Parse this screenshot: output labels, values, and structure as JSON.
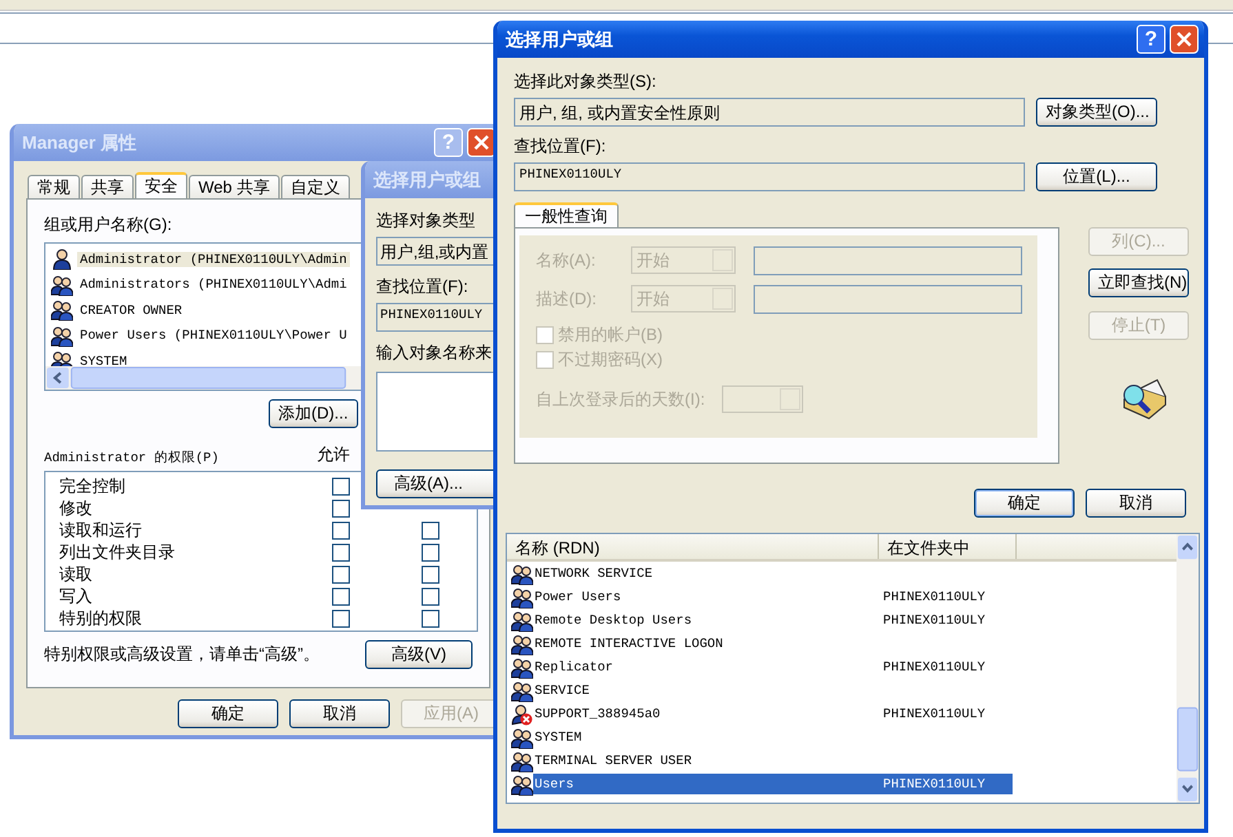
{
  "property_window": {
    "title": "Manager 属性",
    "help": "?",
    "tabs": [
      {
        "label": "常规",
        "selected": false
      },
      {
        "label": "共享",
        "selected": false
      },
      {
        "label": "安全",
        "selected": true
      },
      {
        "label": "Web 共享",
        "selected": false
      },
      {
        "label": "自定义",
        "selected": false
      }
    ],
    "group_label": "组或用户名称(G):",
    "groups": [
      {
        "name": "Administrator (PHINEX0110ULY\\Admin",
        "kind": "user",
        "selected": true
      },
      {
        "name": "Administrators (PHINEX0110ULY\\Admi",
        "kind": "group",
        "selected": false
      },
      {
        "name": "CREATOR OWNER",
        "kind": "group",
        "selected": false
      },
      {
        "name": "Power Users (PHINEX0110ULY\\Power U",
        "kind": "group",
        "selected": false
      },
      {
        "name": "SYSTEM",
        "kind": "group",
        "selected": false
      }
    ],
    "add_button": "添加(D)...",
    "permissions_label": "Administrator 的权限(P)",
    "allow_header": "允许",
    "permissions": [
      {
        "name": "完全控制",
        "allow": false
      },
      {
        "name": "修改",
        "allow": false
      },
      {
        "name": "读取和运行",
        "allow": false,
        "deny": false
      },
      {
        "name": "列出文件夹目录",
        "allow": false,
        "deny": false
      },
      {
        "name": "读取",
        "allow": false,
        "deny": false
      },
      {
        "name": "写入",
        "allow": false,
        "deny": false
      },
      {
        "name": "特别的权限",
        "allow": false,
        "deny": false
      }
    ],
    "advanced_hint": "特别权限或高级设置，请单击“高级”。",
    "advanced_button": "高级(V)",
    "buttons": [
      {
        "label": "确定",
        "disabled": false
      },
      {
        "label": "取消",
        "disabled": false
      },
      {
        "label": "应用(A)",
        "disabled": true
      }
    ]
  },
  "middle_window": {
    "title": "选择用户或组",
    "type_label": "选择对象类型",
    "type_value": "用户,组,或内置",
    "location_label": "查找位置(F):",
    "location_value": "PHINEX0110ULY",
    "names_label": "输入对象名称来",
    "advanced_button": "高级(A)..."
  },
  "select_window": {
    "title": "选择用户或组",
    "help": "?",
    "type_label": "选择此对象类型(S):",
    "type_value": "用户, 组, 或内置安全性原则",
    "type_button": "对象类型(O)...",
    "location_label": "查找位置(F):",
    "location_value": "PHINEX0110ULY",
    "location_button": "位置(L)...",
    "query_tab": {
      "label": "一般性查询",
      "selected": true
    },
    "name_label": "名称(A):",
    "name_mode": "开始",
    "desc_label": "描述(D):",
    "desc_mode": "开始",
    "checkboxes": [
      {
        "label": "禁用的帐户(B)",
        "checked": false
      },
      {
        "label": "不过期密码(X)",
        "checked": false
      }
    ],
    "days_label": "自上次登录后的天数(I):",
    "side_buttons": [
      {
        "label": "列(C)...",
        "disabled": true
      },
      {
        "label": "立即查找(N)",
        "disabled": false
      },
      {
        "label": "停止(T)",
        "disabled": true
      }
    ],
    "ok": "确定",
    "cancel": "取消",
    "results": {
      "columns": [
        "名称 (RDN)",
        "在文件夹中"
      ],
      "rows": [
        {
          "name": "NETWORK SERVICE",
          "kind": "group",
          "selected": false
        },
        {
          "name": "Power Users",
          "folder": "PHINEX0110ULY",
          "kind": "group",
          "selected": false
        },
        {
          "name": "Remote Desktop Users",
          "folder": "PHINEX0110ULY",
          "kind": "group",
          "selected": false
        },
        {
          "name": "REMOTE INTERACTIVE LOGON",
          "kind": "group",
          "selected": false
        },
        {
          "name": "Replicator",
          "folder": "PHINEX0110ULY",
          "kind": "group",
          "selected": false
        },
        {
          "name": "SERVICE",
          "kind": "group",
          "selected": false
        },
        {
          "name": "SUPPORT_388945a0",
          "folder": "PHINEX0110ULY",
          "kind": "disabled-user",
          "selected": false
        },
        {
          "name": "SYSTEM",
          "kind": "group",
          "selected": false
        },
        {
          "name": "TERMINAL SERVER USER",
          "kind": "group",
          "selected": false
        },
        {
          "name": "Users",
          "folder": "PHINEX0110ULY",
          "kind": "group",
          "selected": true
        }
      ]
    }
  }
}
